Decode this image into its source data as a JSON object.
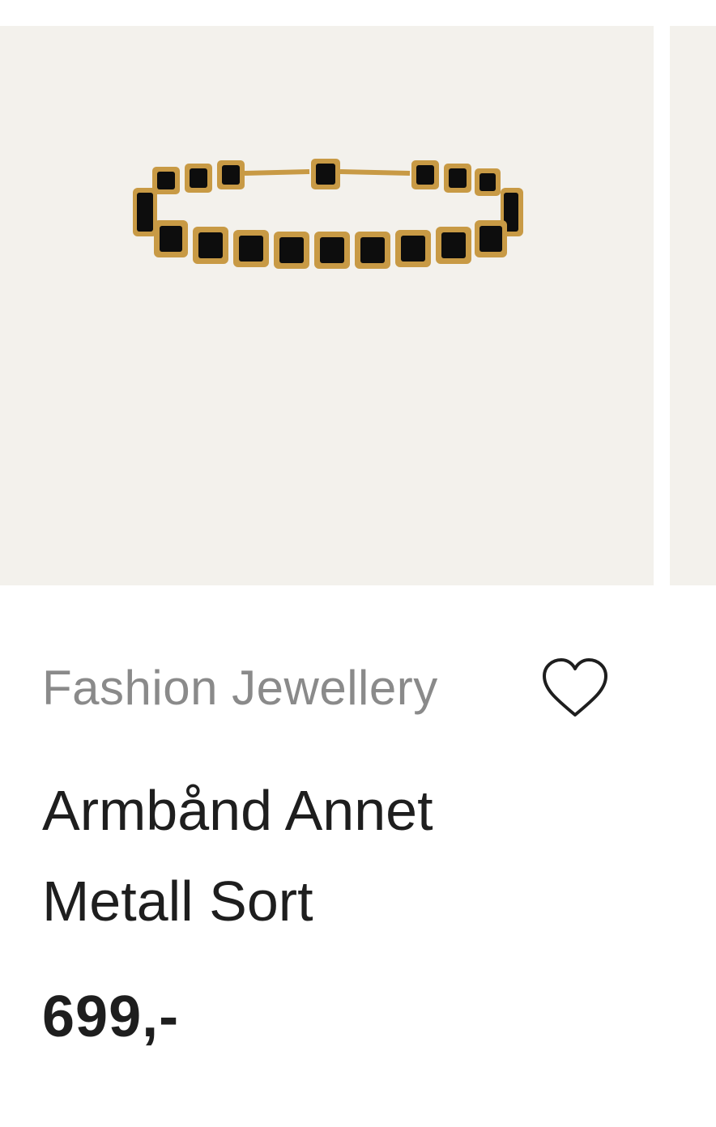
{
  "products": [
    {
      "brand": "Fashion Jewellery",
      "title_line1": "Armbånd Annet",
      "title_line2": "Metall Sort",
      "price": "699,-",
      "image_bg": "#f3f1ec",
      "favorite_icon": "heart-outline-icon"
    }
  ],
  "colors": {
    "text_primary": "#1e1e1e",
    "text_secondary": "#8a8a8a",
    "image_background": "#f3f1ec",
    "gold": "#c89a45",
    "stone": "#0d0d0d"
  }
}
